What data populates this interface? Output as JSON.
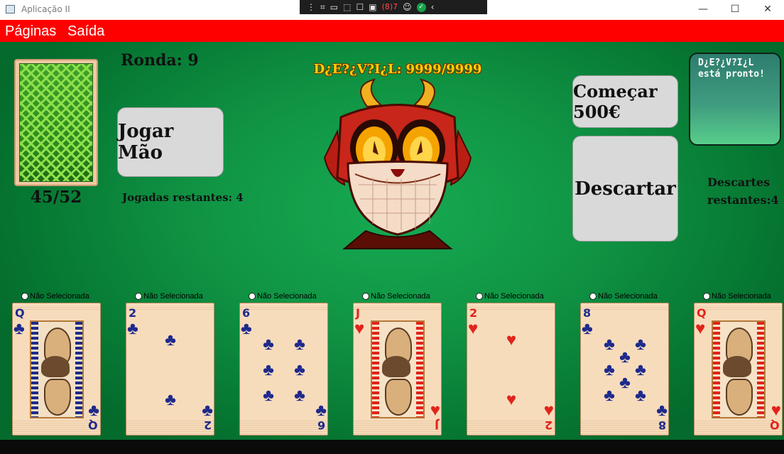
{
  "window": {
    "title": "Aplicação II",
    "controls": {
      "minimize": "—",
      "maximize": "☐",
      "close": "✕"
    }
  },
  "debug_toolbar": {
    "badge": "(8)7"
  },
  "menu": {
    "items": [
      "Páginas",
      "Saída"
    ]
  },
  "game": {
    "deck_count": "45/52",
    "round_label": "Ronda: 9",
    "play_button": "Jogar Mão",
    "plays_remaining": "Jogadas restantes: 4",
    "boss_hp": "D¿E?¿V?I¿L: 9999/9999",
    "start_button": "Começar 500€",
    "discard_button": "Descartar",
    "message": "D¿E?¿V?I¿L\nestá pronto!",
    "discards_remaining": "Descartes\nrestantes:4"
  },
  "hand": {
    "select_label": "Não Selecionada",
    "cards": [
      {
        "rank": "Q",
        "suit": "♣",
        "color": "#1e2a8c",
        "kind": "face"
      },
      {
        "rank": "2",
        "suit": "♣",
        "color": "#1e2a8c",
        "kind": "pips"
      },
      {
        "rank": "6",
        "suit": "♣",
        "color": "#1e2a8c",
        "kind": "pips"
      },
      {
        "rank": "J",
        "suit": "♥",
        "color": "#e0241b",
        "kind": "face"
      },
      {
        "rank": "2",
        "suit": "♥",
        "color": "#e0241b",
        "kind": "pips"
      },
      {
        "rank": "8",
        "suit": "♣",
        "color": "#1e2a8c",
        "kind": "pips"
      },
      {
        "rank": "Q",
        "suit": "♥",
        "color": "#e0241b",
        "kind": "face"
      }
    ]
  },
  "colors": {
    "menu_bar": "#ff0000",
    "felt": "#109444",
    "boss_text": "#ffd000",
    "button": "#d9d9d9"
  }
}
